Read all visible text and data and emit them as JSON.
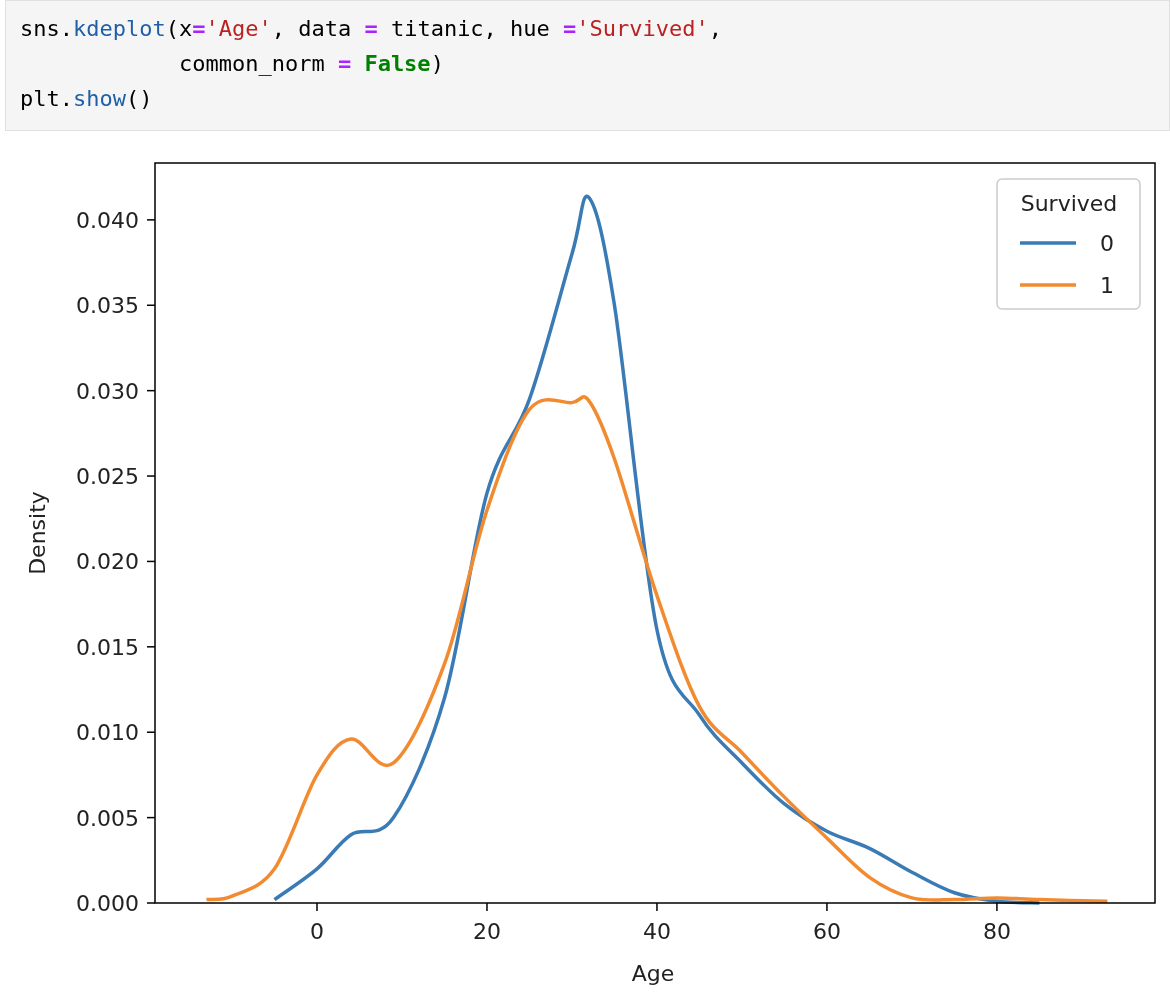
{
  "code_cell": {
    "lines": [
      [
        {
          "text": "sns.",
          "kind": "plain"
        },
        {
          "text": "kdeplot",
          "kind": "func"
        },
        {
          "text": "(x",
          "kind": "plain"
        },
        {
          "text": "=",
          "kind": "op"
        },
        {
          "text": "'Age'",
          "kind": "str"
        },
        {
          "text": ", data ",
          "kind": "plain"
        },
        {
          "text": "=",
          "kind": "op"
        },
        {
          "text": " titanic, hue ",
          "kind": "plain"
        },
        {
          "text": "=",
          "kind": "op"
        },
        {
          "text": "'Survived'",
          "kind": "str"
        },
        {
          "text": ",",
          "kind": "plain"
        }
      ],
      [
        {
          "text": "            common_norm ",
          "kind": "plain"
        },
        {
          "text": "=",
          "kind": "op"
        },
        {
          "text": " False",
          "kind": "kw"
        },
        {
          "text": ")",
          "kind": "plain"
        }
      ],
      [
        {
          "text": "plt.",
          "kind": "plain"
        },
        {
          "text": "show",
          "kind": "func"
        },
        {
          "text": "()",
          "kind": "plain"
        }
      ]
    ]
  },
  "output": {
    "chart_data": {
      "type": "line",
      "xlabel": "Age",
      "ylabel": "Density",
      "x": [
        -13,
        -10,
        -5,
        0,
        4,
        9,
        15,
        20,
        25,
        30,
        32,
        35,
        40,
        45,
        50,
        55,
        60,
        65,
        70,
        75,
        80,
        85,
        93
      ],
      "series": [
        {
          "name": "0",
          "color": "#3a7bb5",
          "values": [
            null,
            null,
            0.0002,
            0.002,
            0.004,
            0.005,
            0.012,
            0.024,
            0.0295,
            0.038,
            0.0413,
            0.035,
            0.016,
            0.011,
            0.0082,
            0.0058,
            0.0042,
            0.0032,
            0.0018,
            0.0006,
            0.0001,
            0.0,
            null
          ]
        },
        {
          "name": "1",
          "color": "#f28a30",
          "values": [
            0.0002,
            0.0004,
            0.002,
            0.0075,
            0.0096,
            0.0082,
            0.014,
            0.023,
            0.0289,
            0.0293,
            0.0294,
            0.026,
            0.018,
            0.0115,
            0.0088,
            0.0062,
            0.0038,
            0.0015,
            0.0003,
            0.0002,
            0.0003,
            0.0002,
            0.0001
          ]
        }
      ],
      "legend": {
        "title": "Survived"
      },
      "xlim": [
        -19.06,
        98.6
      ],
      "ylim": [
        0,
        0.04333
      ],
      "xticks": [
        0,
        20,
        40,
        60,
        80
      ],
      "yticks": [
        {
          "value": 0,
          "label": "0.000"
        },
        {
          "value": 0.005,
          "label": "0.005"
        },
        {
          "value": 0.01,
          "label": "0.010"
        },
        {
          "value": 0.015,
          "label": "0.015"
        },
        {
          "value": 0.02,
          "label": "0.020"
        },
        {
          "value": 0.025,
          "label": "0.025"
        },
        {
          "value": 0.03,
          "label": "0.030"
        },
        {
          "value": 0.035,
          "label": "0.035"
        },
        {
          "value": 0.04,
          "label": "0.040"
        }
      ]
    }
  }
}
